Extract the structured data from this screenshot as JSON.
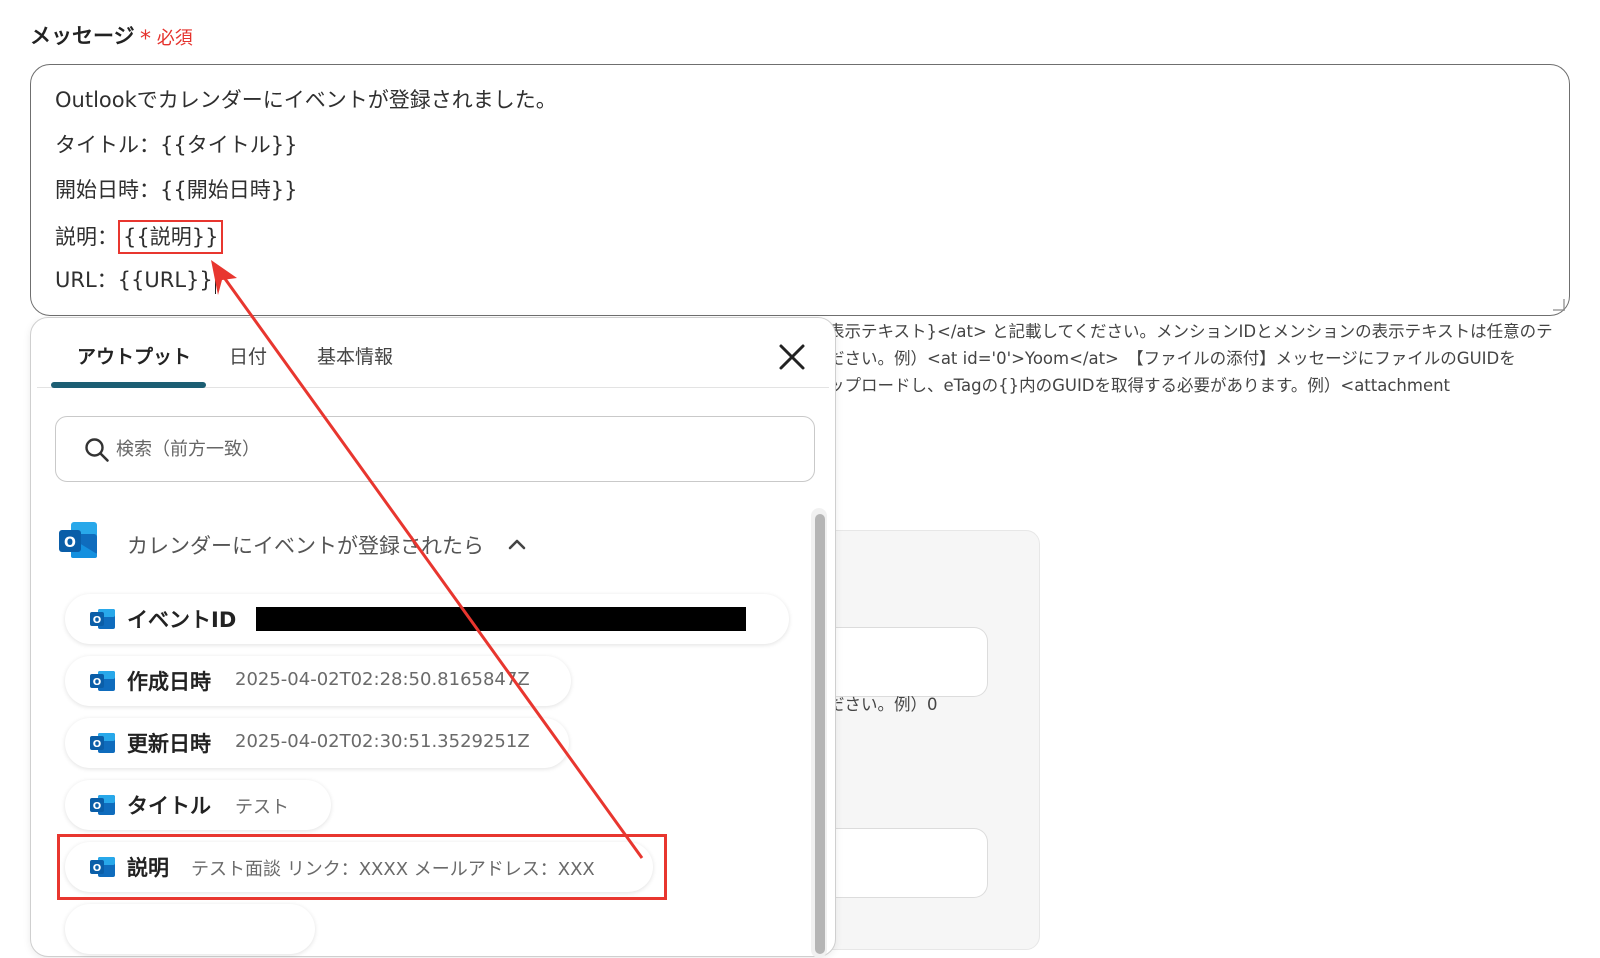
{
  "field": {
    "label": "メッセージ",
    "required": "必須"
  },
  "message": {
    "line1": "Outlookでカレンダーにイベントが登録されました。",
    "line2": "タイトル：{{タイトル}}",
    "line3_prefix": "開始日時：{{開始日時}}",
    "line4_prefix": "説明：",
    "line4_var": "{{説明}}",
    "line5": "URL：{{URL}}"
  },
  "help": {
    "lines": [
      "表示テキスト}</at> と記載してください。メンションIDとメンションの表示テキストは任意のテ",
      "ださい。例）<at id='0'>Yoom</at>　【ファイルの添付】メッセージにファイルのGUIDを",
      "ップロードし、eTagの{}内のGUIDを取得する必要があります。例）<attachment"
    ],
    "second": "ださい。例）0"
  },
  "panel": {
    "tabs": [
      "アウトプット",
      "日付",
      "基本情報"
    ],
    "search_placeholder": "検索（前方一致）",
    "group_title": "カレンダーにイベントが登録されたら",
    "items": [
      {
        "key": "イベントID",
        "value": ""
      },
      {
        "key": "作成日時",
        "value": "2025-04-02T02:28:50.8165847Z"
      },
      {
        "key": "更新日時",
        "value": "2025-04-02T02:30:51.3529251Z"
      },
      {
        "key": "タイトル",
        "value": "テスト"
      },
      {
        "key": "説明",
        "value": "テスト面談 リンク：XXXX メールアドレス：XXX"
      }
    ]
  },
  "colors": {
    "accent": "#1c5e73",
    "highlight": "#e8362f",
    "outlook": "#0f6cbd"
  },
  "icons": {
    "close": "close-icon",
    "search": "search-icon",
    "outlook": "outlook-icon",
    "chevron": "chevron-up-icon"
  }
}
